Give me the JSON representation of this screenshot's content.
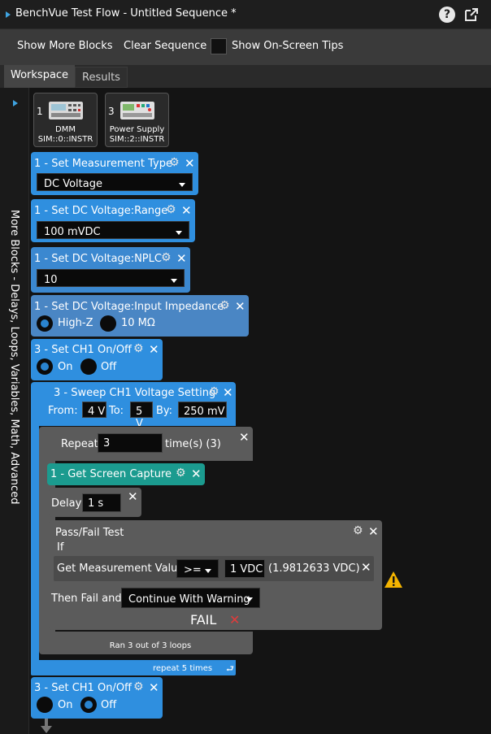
{
  "window": {
    "title": "BenchVue Test Flow - Untitled Sequence *"
  },
  "toolbar": {
    "show_more_blocks": "Show More Blocks",
    "clear_sequence": "Clear Sequence",
    "show_tips": "Show On-Screen Tips"
  },
  "tabs": {
    "workspace": "Workspace",
    "results": "Results"
  },
  "sidebar": {
    "label": "More Blocks - Delays, Loops, Variables, Math, Advanced"
  },
  "instruments": [
    {
      "num": "1",
      "name": "DMM",
      "address": "SIM::0::INSTR"
    },
    {
      "num": "3",
      "name": "Power Supply",
      "address": "SIM::2::INSTR"
    }
  ],
  "blocks": {
    "b1": {
      "title": "1 - Set Measurement Type",
      "value": "DC Voltage"
    },
    "b2": {
      "title": "1 - Set DC Voltage:Range",
      "value": "100 mVDC"
    },
    "b3": {
      "title": "1 - Set DC Voltage:NPLC",
      "value": "10"
    },
    "b4": {
      "title": "1 - Set DC Voltage:Input Impedance",
      "opt1": "High-Z",
      "opt2": "10 MΩ",
      "selected": "High-Z"
    },
    "b5": {
      "title": "3 - Set CH1 On/Off",
      "opt1": "On",
      "opt2": "Off",
      "selected": "On"
    },
    "b6": {
      "title": "3 - Sweep CH1 Voltage Setting",
      "from_label": "From:",
      "from": "4 V",
      "to_label": "To:",
      "to": "5 V",
      "by_label": "By:",
      "by": "250 mV"
    },
    "b7": {
      "label": "Repeat",
      "value": "3",
      "suffix": "time(s) (3)"
    },
    "b8": {
      "title": "1 - Get Screen Capture"
    },
    "b9": {
      "label": "Delay",
      "value": "1 s"
    },
    "b10": {
      "title": "Pass/Fail Test",
      "if_label": "If",
      "measurement_label": "Get Measurement Value",
      "operator": ">=",
      "limit": "1 VDC",
      "measured": "(1.9812633 VDC)",
      "then_label": "Then Fail and",
      "action": "Continue With Warning",
      "result": "FAIL"
    },
    "loop_status": "Ran 3 out of 3 loops",
    "repeat_status": "repeat 5 times",
    "b11": {
      "title": "3 - Set CH1 On/Off",
      "opt1": "On",
      "opt2": "Off",
      "selected": "Off"
    }
  },
  "colors": {
    "accent": "#2f8fdf",
    "teal_block": "#1b9b8f",
    "steel_block": "#4a86c4",
    "warning": "#f4b400",
    "fail": "#e23b3b"
  }
}
